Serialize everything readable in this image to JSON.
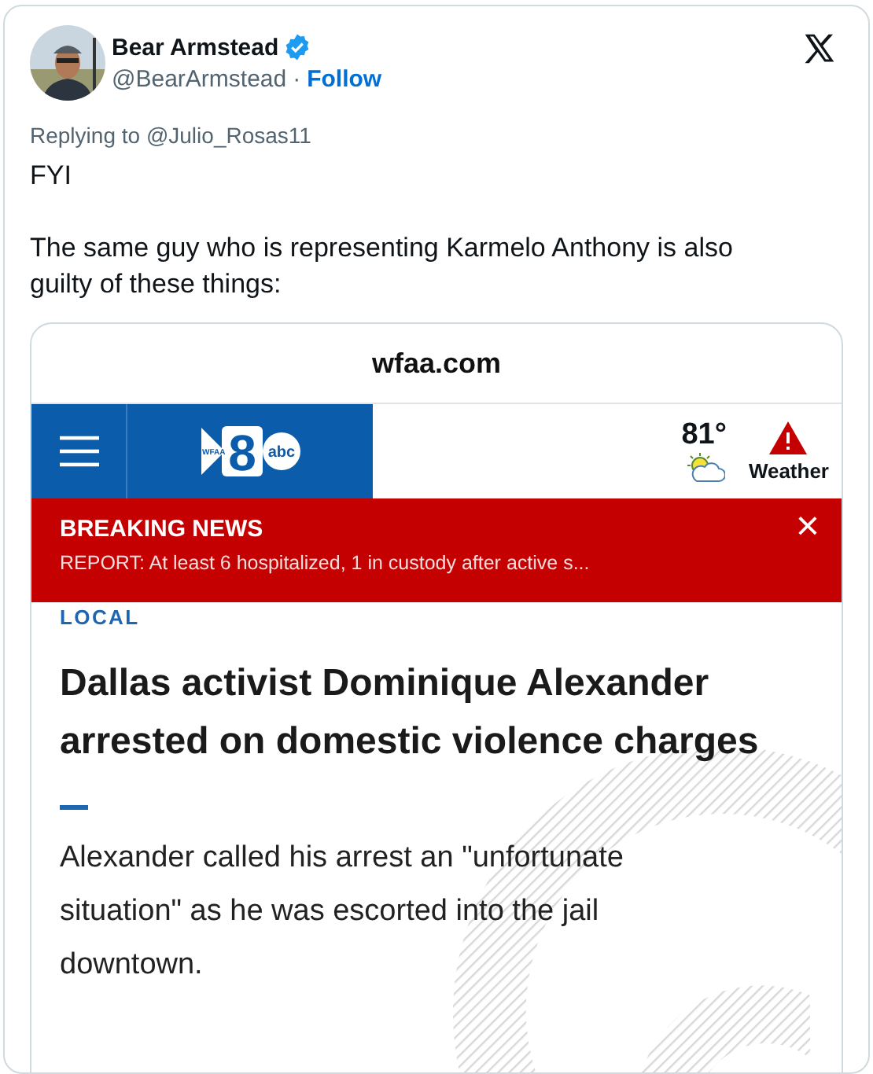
{
  "author": {
    "name": "Bear Armstead",
    "verified": true,
    "handle": "@BearArmstead",
    "separator": "·",
    "follow": "Follow"
  },
  "reply_to": {
    "prefix": "Replying to",
    "handle": "@Julio_Rosas11"
  },
  "text": [
    "FYI",
    "The same guy who is representing Karmelo Anthony is also guilty of these things:"
  ],
  "screenshot": {
    "url": "wfaa.com",
    "logo": {
      "mark": "WFAA",
      "number": "8",
      "network": "abc"
    },
    "weather": {
      "temperature": "81°",
      "label": "Weather"
    },
    "banner": {
      "title": "BREAKING NEWS",
      "text": "REPORT: At least 6 hospitalized, 1 in custody after active s...",
      "close": "×"
    },
    "section": "LOCAL",
    "headline": "Dallas activist Dominique Alexander arrested on domestic violence charges",
    "summary": "Alexander called his arrest an \"unfortunate situation\" as he was escorted into the jail downtown."
  }
}
